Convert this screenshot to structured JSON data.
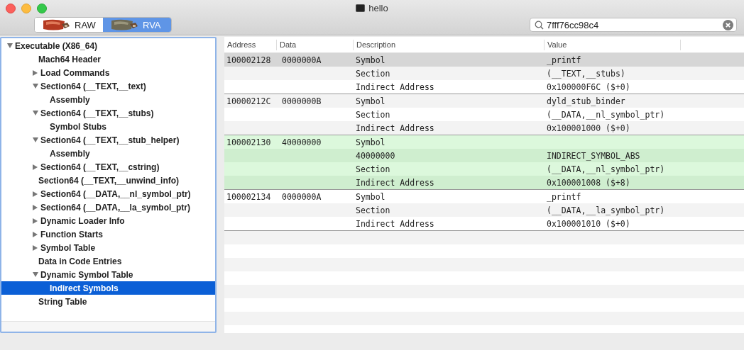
{
  "window": {
    "title": "hello"
  },
  "segments": [
    {
      "label": "RAW",
      "selected": false
    },
    {
      "label": "RVA",
      "selected": true
    }
  ],
  "search": {
    "value": "7fff76cc98c4"
  },
  "tree": [
    {
      "label": "Executable  (X86_64)",
      "expanded": true,
      "selected": false,
      "children": [
        {
          "label": "Mach64 Header",
          "selected": false
        },
        {
          "label": "Load Commands",
          "expanded": false,
          "selected": false
        },
        {
          "label": "Section64 (__TEXT,__text)",
          "expanded": true,
          "selected": false,
          "children": [
            {
              "label": "Assembly",
              "selected": false
            }
          ]
        },
        {
          "label": "Section64 (__TEXT,__stubs)",
          "expanded": true,
          "selected": false,
          "children": [
            {
              "label": "Symbol Stubs",
              "selected": false
            }
          ]
        },
        {
          "label": "Section64 (__TEXT,__stub_helper)",
          "expanded": true,
          "selected": false,
          "children": [
            {
              "label": "Assembly",
              "selected": false
            }
          ]
        },
        {
          "label": "Section64 (__TEXT,__cstring)",
          "expanded": false,
          "selected": false
        },
        {
          "label": "Section64 (__TEXT,__unwind_info)",
          "selected": false
        },
        {
          "label": "Section64 (__DATA,__nl_symbol_ptr)",
          "expanded": false,
          "selected": false
        },
        {
          "label": "Section64 (__DATA,__la_symbol_ptr)",
          "expanded": false,
          "selected": false
        },
        {
          "label": "Dynamic Loader Info",
          "expanded": false,
          "selected": false
        },
        {
          "label": "Function Starts",
          "expanded": false,
          "selected": false
        },
        {
          "label": "Symbol Table",
          "expanded": false,
          "selected": false
        },
        {
          "label": "Data in Code Entries",
          "selected": false
        },
        {
          "label": "Dynamic Symbol Table",
          "expanded": true,
          "selected": false,
          "children": [
            {
              "label": "Indirect Symbols",
              "selected": true
            }
          ]
        },
        {
          "label": "String Table",
          "selected": false
        }
      ]
    }
  ],
  "table": {
    "columns": [
      "Address",
      "Data",
      "Description",
      "Value"
    ],
    "groups": [
      {
        "highlighted": false,
        "rows": [
          {
            "address": "100002128",
            "data": "0000000A",
            "description": "Symbol",
            "value": "_printf",
            "selected": true
          },
          {
            "description": "Section",
            "value": "(__TEXT,__stubs)",
            "selected": false
          },
          {
            "description": "Indirect Address",
            "value": "0x100000F6C ($+0)",
            "selected": false
          }
        ]
      },
      {
        "highlighted": false,
        "rows": [
          {
            "address": "10000212C",
            "data": "0000000B",
            "description": "Symbol",
            "value": "dyld_stub_binder",
            "selected": false
          },
          {
            "description": "Section",
            "value": "(__DATA,__nl_symbol_ptr)",
            "selected": false
          },
          {
            "description": "Indirect Address",
            "value": "0x100001000 ($+0)",
            "selected": false
          }
        ]
      },
      {
        "highlighted": true,
        "rows": [
          {
            "address": "100002130",
            "data": "40000000",
            "description": "Symbol",
            "selected": false
          },
          {
            "description": "40000000",
            "value": "INDIRECT_SYMBOL_ABS",
            "selected": false
          },
          {
            "description": "Section",
            "value": "(__DATA,__nl_symbol_ptr)",
            "selected": false
          },
          {
            "description": "Indirect Address",
            "value": "0x100001008 ($+8)",
            "selected": false
          }
        ]
      },
      {
        "highlighted": false,
        "rows": [
          {
            "address": "100002134",
            "data": "0000000A",
            "description": "Symbol",
            "value": "_printf",
            "selected": false
          },
          {
            "description": "Section",
            "value": "(__DATA,__la_symbol_ptr)",
            "selected": false
          },
          {
            "description": "Indirect Address",
            "value": "0x100001010 ($+0)",
            "selected": false
          }
        ]
      }
    ]
  }
}
